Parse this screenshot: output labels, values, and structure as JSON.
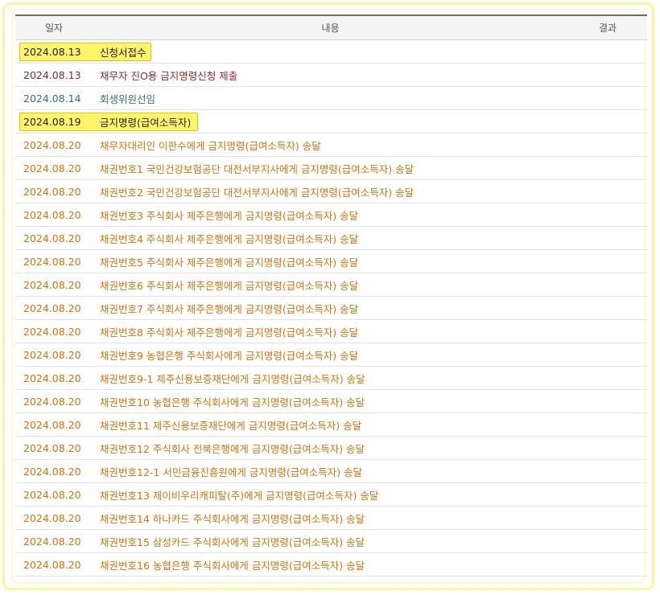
{
  "header": {
    "date": "일자",
    "content": "내용",
    "result": "결과"
  },
  "colors": {
    "orange": "#d4740c",
    "maroon": "#8a2a2a",
    "green": "#2e7d4f",
    "black": "#222222",
    "highlight": "#fff56a"
  },
  "rows": [
    {
      "date": "2024.08.13",
      "content": "신청서접수",
      "color": "black",
      "highlighted": true
    },
    {
      "date": "2024.08.13",
      "content": "채무자 진O용 금지명령신청 제출",
      "color": "maroon",
      "highlighted": false
    },
    {
      "date": "2024.08.14",
      "content": "회생위원선임",
      "color": "green",
      "highlighted": false
    },
    {
      "date": "2024.08.19",
      "content": "금지명령(급여소득자)",
      "color": "black",
      "highlighted": true
    },
    {
      "date": "2024.08.20",
      "content": "채무자대리인 이판수에게 금지명령(급여소득자) 송달",
      "color": "orange",
      "highlighted": false
    },
    {
      "date": "2024.08.20",
      "content": "채권번호1 국민건강보험공단 대전서부지사에게 금지명령(급여소득자) 송달",
      "color": "orange",
      "highlighted": false
    },
    {
      "date": "2024.08.20",
      "content": "채권번호2 국민건강보험공단 대전서부지사에게 금지명령(급여소득자) 송달",
      "color": "orange",
      "highlighted": false
    },
    {
      "date": "2024.08.20",
      "content": "채권번호3 주식회사 제주은행에게 금지명령(급여소득자) 송달",
      "color": "orange",
      "highlighted": false
    },
    {
      "date": "2024.08.20",
      "content": "채권번호4 주식회사 제주은행에게 금지명령(급여소득자) 송달",
      "color": "orange",
      "highlighted": false
    },
    {
      "date": "2024.08.20",
      "content": "채권번호5 주식회사 제주은행에게 금지명령(급여소득자) 송달",
      "color": "orange",
      "highlighted": false
    },
    {
      "date": "2024.08.20",
      "content": "채권번호6 주식회사 제주은행에게 금지명령(급여소득자) 송달",
      "color": "orange",
      "highlighted": false
    },
    {
      "date": "2024.08.20",
      "content": "채권번호7 주식회사 제주은행에게 금지명령(급여소득자) 송달",
      "color": "orange",
      "highlighted": false
    },
    {
      "date": "2024.08.20",
      "content": "채권번호8 주식회사 제주은행에게 금지명령(급여소득자) 송달",
      "color": "orange",
      "highlighted": false
    },
    {
      "date": "2024.08.20",
      "content": "채권번호9 농협은행 주식회사에게 금지명령(급여소득자) 송달",
      "color": "orange",
      "highlighted": false
    },
    {
      "date": "2024.08.20",
      "content": "채권번호9-1 제주신용보증재단에게 금지명령(급여소득자) 송달",
      "color": "orange",
      "highlighted": false
    },
    {
      "date": "2024.08.20",
      "content": "채권번호10 농협은행 주식회사에게 금지명령(급여소득자) 송달",
      "color": "orange",
      "highlighted": false
    },
    {
      "date": "2024.08.20",
      "content": "채권번호11 제주신용보증재단에게 금지명령(급여소득자) 송달",
      "color": "orange",
      "highlighted": false
    },
    {
      "date": "2024.08.20",
      "content": "채권번호12 주식회사 전북은행에게 금지명령(급여소득자) 송달",
      "color": "orange",
      "highlighted": false
    },
    {
      "date": "2024.08.20",
      "content": "채권번호12-1 서민금융진흥원에게 금지명령(급여소득자) 송달",
      "color": "orange",
      "highlighted": false
    },
    {
      "date": "2024.08.20",
      "content": "채권번호13 제이비우리캐피탈(주)에게 금지명령(급여소득자) 송달",
      "color": "orange",
      "highlighted": false
    },
    {
      "date": "2024.08.20",
      "content": "채권번호14 하나카드 주식회사에게 금지명령(급여소득자) 송달",
      "color": "orange",
      "highlighted": false
    },
    {
      "date": "2024.08.20",
      "content": "채권번호15 삼성카드 주식회사에게 금지명령(급여소득자) 송달",
      "color": "orange",
      "highlighted": false
    },
    {
      "date": "2024.08.20",
      "content": "채권번호16 농협은행 주식회사에게 금지명령(급여소득자) 송달",
      "color": "orange",
      "highlighted": false
    }
  ]
}
